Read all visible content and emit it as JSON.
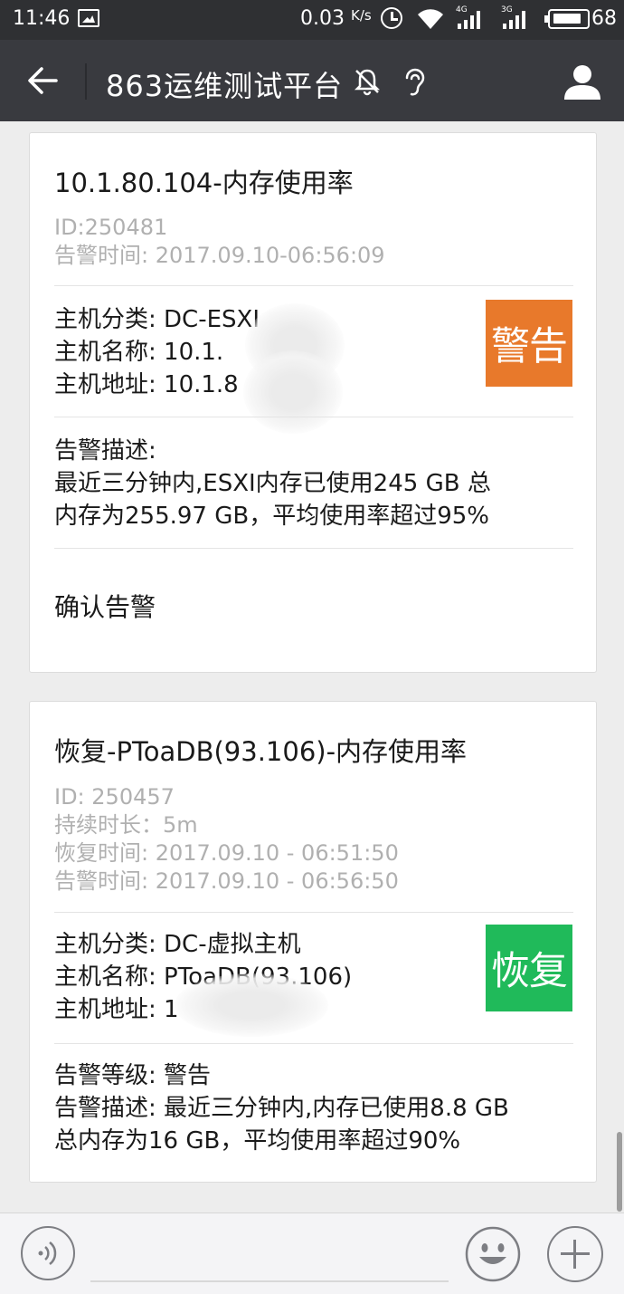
{
  "status_bar": {
    "time": "11:46",
    "net_speed": "0.03",
    "net_speed_unit": "K/s",
    "sim1_label": "4G",
    "sim2_label": "3G",
    "battery": "68"
  },
  "header": {
    "title": "863运维测试平台",
    "icons": [
      "back-arrow-icon",
      "mute-bell-icon",
      "earpiece-icon",
      "person-icon"
    ]
  },
  "messages": [
    {
      "title": "10.1.80.104-内存使用率",
      "meta": [
        "ID:250481",
        "告警时间: 2017.09.10-06:56:09"
      ],
      "host_lines": [
        "主机分类: DC-ESXI",
        "主机名称: 10.1.",
        "主机地址: 10.1.8"
      ],
      "badge": "警告",
      "badge_color": "#e8792b",
      "desc_lines": [
        "告警描述:",
        "最近三分钟内,ESXI内存已使用245 GB 总",
        "内存为255.97 GB，平均使用率超过95%"
      ],
      "action": "确认告警"
    },
    {
      "title": "恢复-PToaDB(93.106)-内存使用率",
      "meta": [
        "ID: 250457",
        "持续时长：5m",
        "恢复时间: 2017.09.10  -  06:51:50",
        "告警时间: 2017.09.10  -  06:56:50"
      ],
      "host_lines": [
        "主机分类: DC-虚拟主机",
        "主机名称: PToaDB(93.106)",
        "主机地址: 1"
      ],
      "badge": "恢复",
      "badge_color": "#20ba5a",
      "desc_lines": [
        "告警等级: 警告",
        "告警描述: 最近三分钟内,内存已使用8.8 GB",
        "总内存为16 GB，平均使用率超过90%"
      ]
    }
  ],
  "input_bar": {
    "icons": [
      "voice-icon",
      "emoji-icon",
      "plus-icon"
    ]
  }
}
